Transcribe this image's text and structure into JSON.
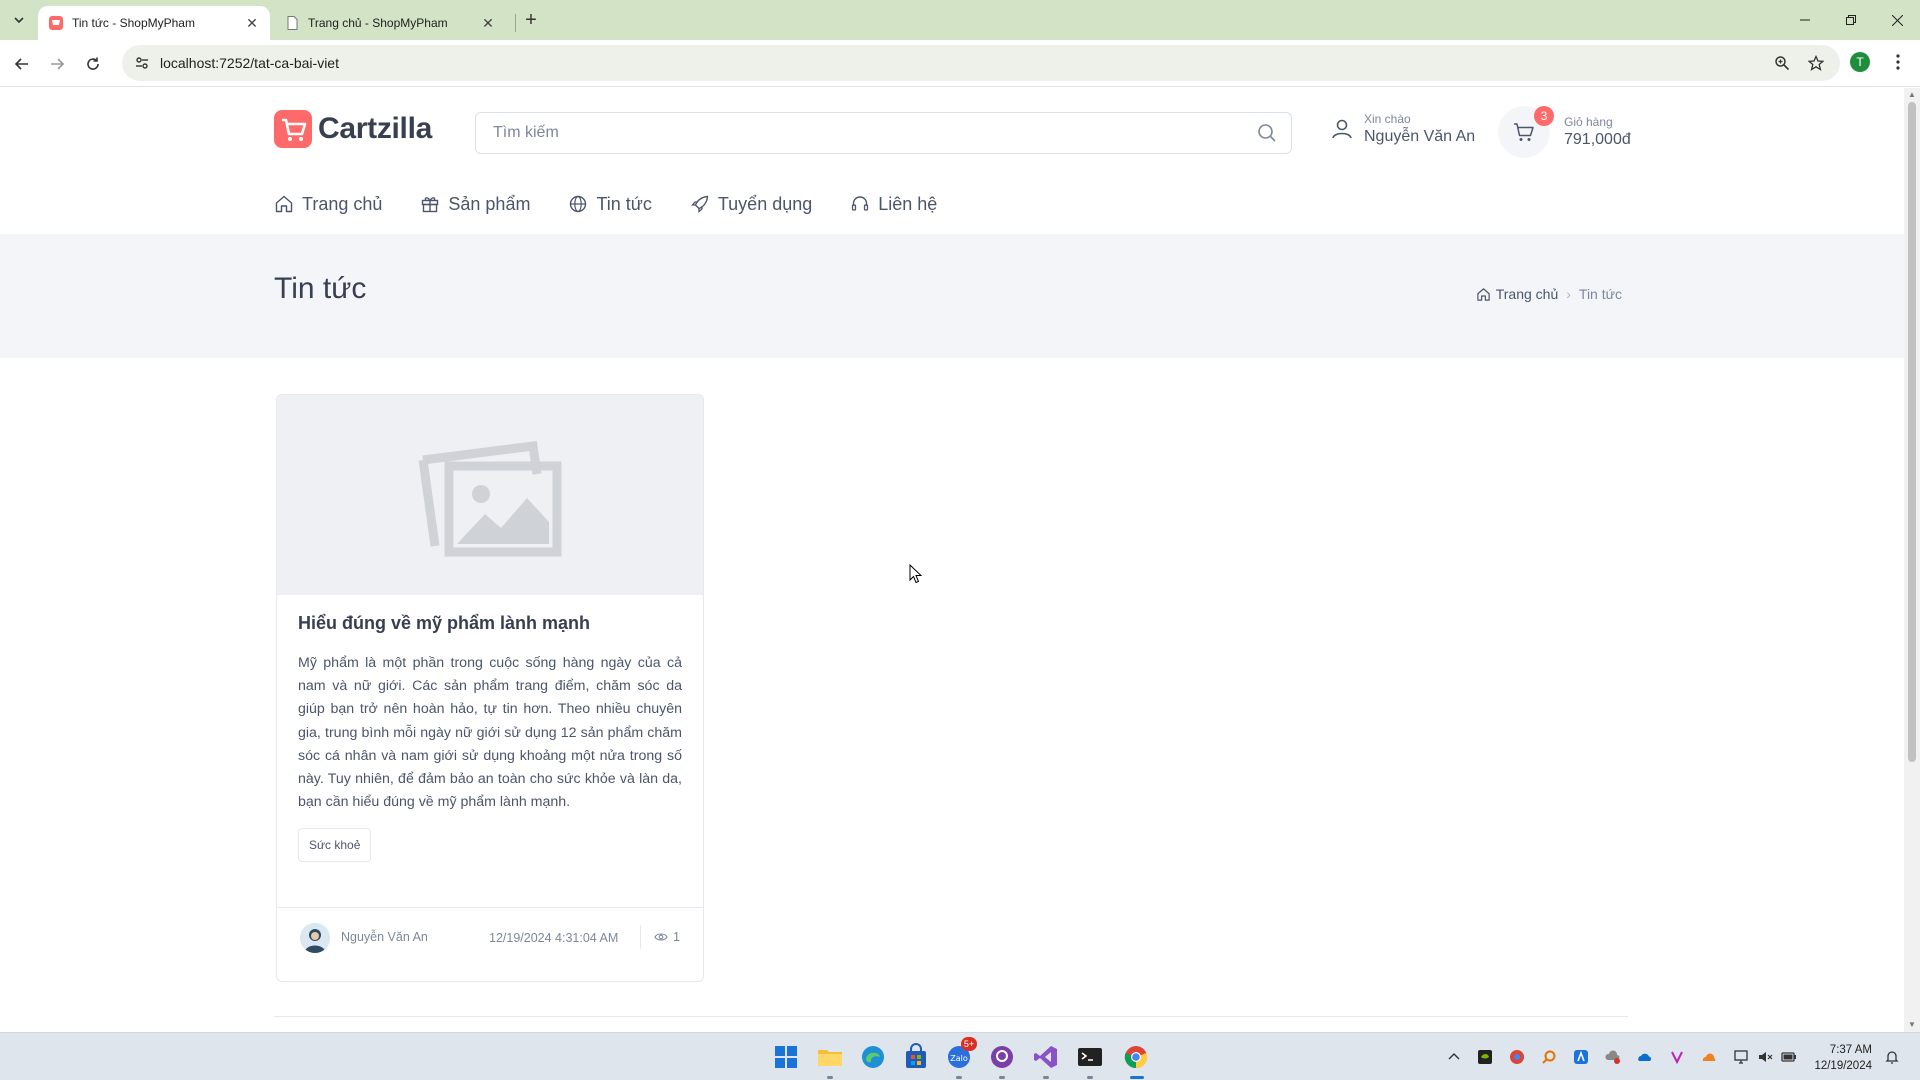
{
  "browser": {
    "tabs": [
      {
        "title": "Tin tức - ShopMyPham",
        "active": true
      },
      {
        "title": "Trang chủ - ShopMyPham",
        "active": false
      }
    ],
    "url": "localhost:7252/tat-ca-bai-viet",
    "profile_initial": "T"
  },
  "header": {
    "brand": "Cartzilla",
    "search_placeholder": "Tìm kiếm",
    "account": {
      "greeting": "Xin chào",
      "name": "Nguyễn Văn An"
    },
    "cart": {
      "label": "Giỏ hàng",
      "total": "791,000đ",
      "count": "3"
    }
  },
  "nav": {
    "items": [
      {
        "label": "Trang chủ",
        "icon": "home-icon"
      },
      {
        "label": "Sản phẩm",
        "icon": "gift-icon"
      },
      {
        "label": "Tin tức",
        "icon": "globe-icon"
      },
      {
        "label": "Tuyển dụng",
        "icon": "rocket-icon"
      },
      {
        "label": "Liên hệ",
        "icon": "headset-icon"
      }
    ]
  },
  "page": {
    "title": "Tin tức",
    "breadcrumb": {
      "home": "Trang chủ",
      "current": "Tin tức"
    }
  },
  "posts": [
    {
      "title": "Hiểu đúng về mỹ phẩm lành mạnh",
      "excerpt": "Mỹ phẩm là một phần trong cuộc sống hàng ngày của cả nam và nữ giới. Các sản phẩm trang điểm, chăm sóc da giúp bạn trở nên hoàn hảo, tự tin hơn. Theo nhiều chuyên gia, trung bình mỗi ngày nữ giới sử dụng 12 sản phẩm chăm sóc cá nhân và nam giới sử dụng khoảng một nửa trong số này. Tuy nhiên, để đảm bảo an toàn cho sức khỏe và làn da, bạn cần hiểu đúng về mỹ phẩm lành mạnh.",
      "tag": "Sức khoẻ",
      "author": "Nguyễn Văn An",
      "date": "12/19/2024 4:31:04 AM",
      "views": "1"
    }
  ],
  "taskbar": {
    "notification_badge": "5+",
    "time": "7:37 AM",
    "date": "12/19/2024"
  },
  "colors": {
    "accent": "#fe696a",
    "band": "#f3f5f9",
    "text": "#373f50"
  }
}
